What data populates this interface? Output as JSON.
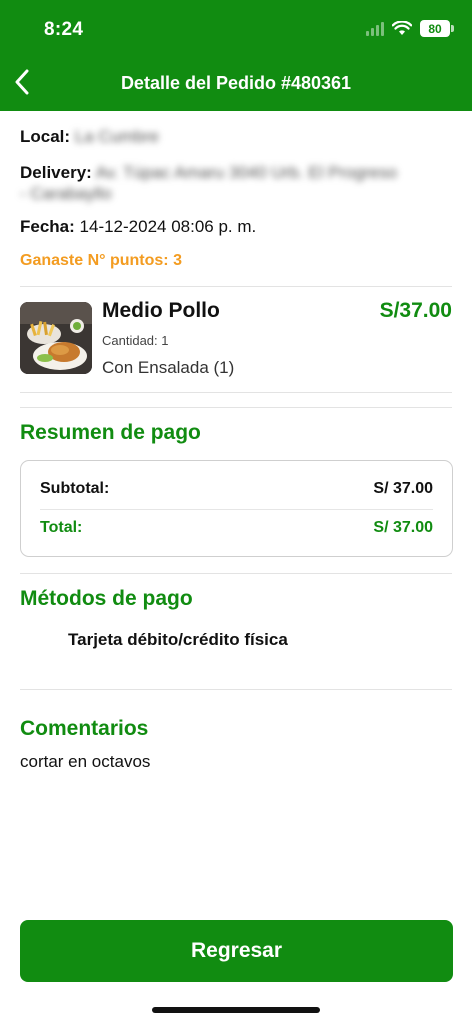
{
  "status_bar": {
    "time": "8:24",
    "battery": "80"
  },
  "header": {
    "title": "Detalle del Pedido #480361"
  },
  "order": {
    "local_label": "Local:",
    "local_value": "La Cumbre",
    "delivery_label": "Delivery:",
    "delivery_value_line1": "Av. Túpac Amaru 3040 Urb. El Progreso",
    "delivery_value_line2": "- Carabayllo",
    "date_label": "Fecha:",
    "date_value": "14-12-2024 08:06 p. m.",
    "points_text": "Ganaste N° puntos: 3"
  },
  "product": {
    "name": "Medio Pollo",
    "price": "S/37.00",
    "quantity": "Cantidad: 1",
    "option": "Con Ensalada (1)"
  },
  "summary": {
    "title": "Resumen de pago",
    "subtotal_label": "Subtotal:",
    "subtotal_value": "S/ 37.00",
    "total_label": "Total:",
    "total_value": "S/ 37.00"
  },
  "payment": {
    "title": "Métodos de pago",
    "method": "Tarjeta débito/crédito física"
  },
  "comments": {
    "title": "Comentarios",
    "text": "cortar en octavos"
  },
  "actions": {
    "back_label": "Regresar"
  },
  "colors": {
    "brand_green": "#118c11",
    "points_orange": "#f39c21"
  },
  "icons": {
    "back": "chevron-left-icon",
    "signal": "signal-icon",
    "wifi": "wifi-icon",
    "battery": "battery-icon"
  }
}
